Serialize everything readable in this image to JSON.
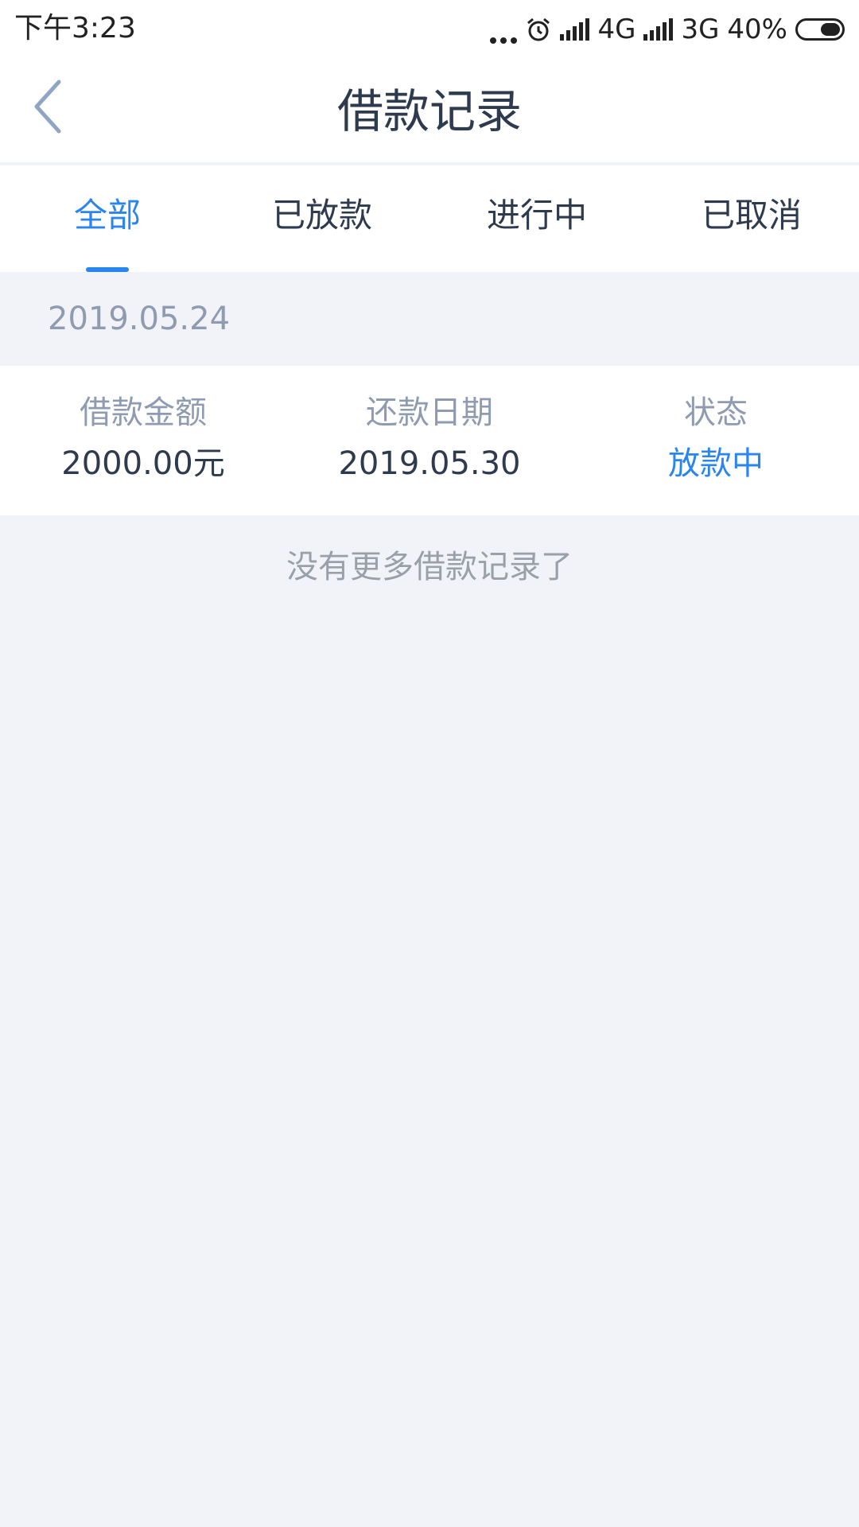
{
  "status_bar": {
    "time": "下午3:23",
    "network_1": "4G",
    "network_2": "3G",
    "battery": "40%"
  },
  "header": {
    "title": "借款记录",
    "back_icon": "chevron-left-icon"
  },
  "tabs": [
    {
      "label": "全部",
      "active": true
    },
    {
      "label": "已放款",
      "active": false
    },
    {
      "label": "进行中",
      "active": false
    },
    {
      "label": "已取消",
      "active": false
    }
  ],
  "records": {
    "date": "2019.05.24",
    "columns": {
      "amount_label": "借款金额",
      "repay_label": "还款日期",
      "status_label": "状态"
    },
    "item": {
      "amount": "2000.00元",
      "repay_date": "2019.05.30",
      "status": "放款中"
    }
  },
  "end_note": "没有更多借款记录了",
  "colors": {
    "accent": "#2b85ef",
    "background": "#f1f3f8",
    "muted_text": "#8e9bb0"
  }
}
